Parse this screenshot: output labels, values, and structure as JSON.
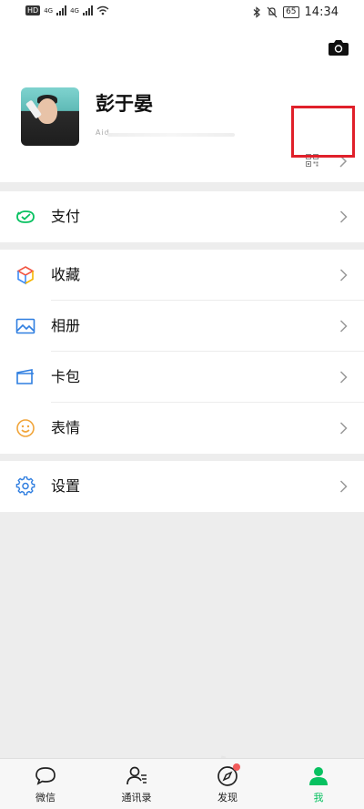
{
  "status_bar": {
    "hd_badge": "HD",
    "network_1": "4G",
    "network_2": "4G",
    "battery": "65",
    "time": "14:34"
  },
  "profile": {
    "nickname": "彭于晏",
    "wechat_id_prefix": "Aid",
    "camera_icon": "camera-icon",
    "qr_icon": "qr-code-icon",
    "highlight_color": "#e0202a"
  },
  "sections": [
    {
      "items": [
        {
          "key": "pay",
          "label": "支付",
          "icon": "wallet-icon"
        }
      ]
    },
    {
      "items": [
        {
          "key": "favorites",
          "label": "收藏",
          "icon": "cube-icon"
        },
        {
          "key": "album",
          "label": "相册",
          "icon": "photo-icon"
        },
        {
          "key": "cards",
          "label": "卡包",
          "icon": "card-icon"
        },
        {
          "key": "stickers",
          "label": "表情",
          "icon": "smiley-icon"
        }
      ]
    },
    {
      "items": [
        {
          "key": "settings",
          "label": "设置",
          "icon": "gear-icon"
        }
      ]
    }
  ],
  "tabs": [
    {
      "label": "微信",
      "icon": "chat-icon"
    },
    {
      "label": "通讯录",
      "icon": "contacts-icon"
    },
    {
      "label": "发现",
      "icon": "compass-icon"
    },
    {
      "label": "我",
      "icon": "person-icon",
      "active": true
    }
  ],
  "colors": {
    "accent": "#07c160",
    "badge": "#f15a5a"
  }
}
